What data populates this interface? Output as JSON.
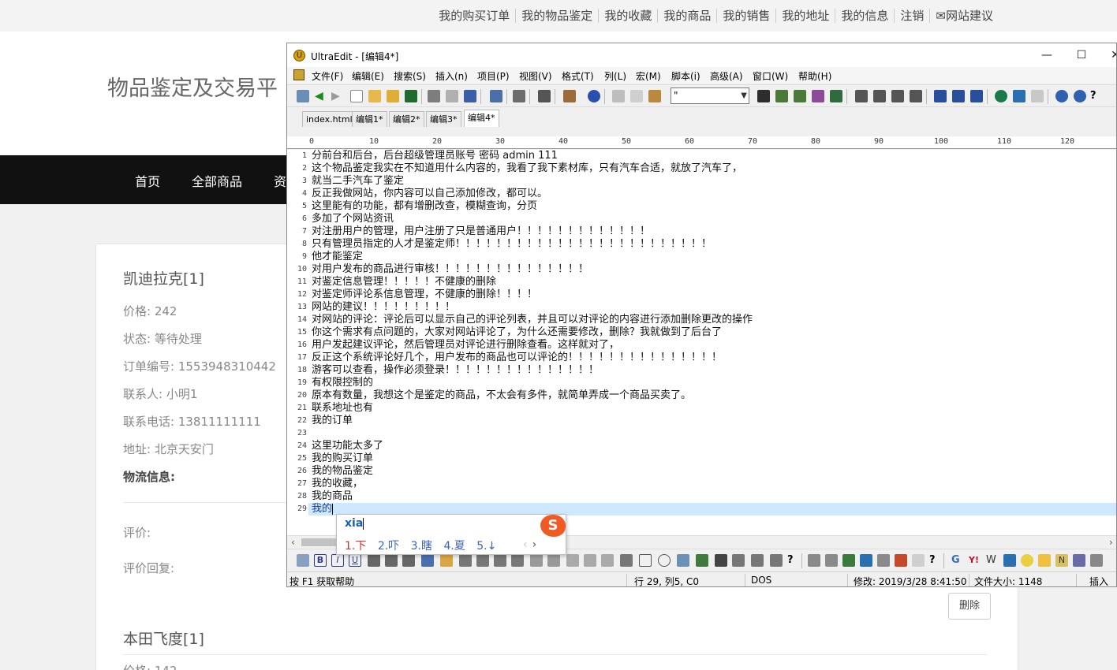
{
  "top_links": [
    "我的购买订单",
    "我的物品鉴定",
    "我的收藏",
    "我的商品",
    "我的销售",
    "我的地址",
    "我的信息",
    "注销",
    "网站建议"
  ],
  "site_title": "物品鉴定及交易平",
  "nav": [
    "首页",
    "全部商品",
    "资"
  ],
  "order1": {
    "title": "凯迪拉克[1]",
    "price": "价格: 242",
    "status": "状态: 等待处理",
    "order_no": "订单编号: 1553948310442",
    "contact": "联系人: 小明1",
    "phone": "联系电话: 13811111111",
    "address": "地址: 北京天安门",
    "logistics": "物流信息:",
    "review": "评价:",
    "review_reply": "评价回复:",
    "delete": "删除"
  },
  "order2": {
    "title": "本田飞度[1]",
    "price": "价格: 142"
  },
  "ue": {
    "title": "UltraEdit - [编辑4*]",
    "menu": [
      "文件(F)",
      "编辑(E)",
      "搜索(S)",
      "插入(n)",
      "项目(P)",
      "视图(V)",
      "格式(T)",
      "列(L)",
      "宏(M)",
      "脚本(i)",
      "高级(A)",
      "窗口(W)",
      "帮助(H)"
    ],
    "combo_value": "\"",
    "tabs": [
      "index.html",
      "编辑1*",
      "编辑2*",
      "编辑3*",
      "编辑4*"
    ],
    "ruler": [
      "0",
      "10",
      "20",
      "30",
      "40",
      "50",
      "60",
      "70",
      "80",
      "90",
      "100",
      "110",
      "120"
    ],
    "lines": [
      "分前台和后台，后台超级管理员账号 密码  admin 111",
      "这个物品鉴定我实在不知道用什么内容的，我看了我下素材库，只有汽车合适，就放了汽车了，",
      "就当二手汽车了鉴定",
      "反正我做网站，你内容可以自己添加修改，都可以。",
      "这里能有的功能，都有增删改查，模糊查询，分页",
      "多加了个网站资讯",
      "对注册用户的管理，用户注册了只是普通用户！！！！！！！！！！！！！",
      "只有管理员指定的人才是鉴定师！！！！！！！！！！！！！！！！！！！！！！！！！",
      "他才能鉴定",
      "对用户发布的商品进行审核！！！！！！！！！！！！！！！",
      "对鉴定信息管理！！！！！不健康的删除",
      "对鉴定师评论系信息管理，不健康的删除！！！！",
      "网站的建议！！！！！！！！！",
      "对网站的评论：评论后可以显示自己的评论列表，并且可以对评论的内容进行添加删除更改的操作",
      "你这个需求有点问题的，大家对网站评论了，为什么还需要修改，删除？我就做到了后台了",
      "用户发起建议评论，然后管理员对评论进行删除查看。这样就对了，",
      "反正这个系统评论好几个，用户发布的商品也可以评论的！！！！！！！！！！！！！！！",
      "游客可以查看，操作必须登录！！！！！！！！！！！！！！！",
      "有权限控制的",
      "原本有数量，我想这个是鉴定的商品，不太会有多件，就简单弄成一个商品买卖了。",
      "联系地址也有",
      "我的订单",
      "",
      "这里功能太多了",
      "我的购买订单",
      "我的物品鉴定",
      "我的收藏，",
      "我的商品",
      "我的"
    ],
    "ime": {
      "input": "xia",
      "logo": "S",
      "candidates": [
        "1.下",
        "2.吓",
        "3.瞎",
        "4.夏",
        "5.↓"
      ]
    },
    "status": {
      "help": "按 F1 获取帮助",
      "position": "行 29, 列5, C0",
      "format": "DOS",
      "modified": "修改: 2019/3/28 8:41:50",
      "size": "文件大小: 1148",
      "mode": "插入"
    }
  }
}
